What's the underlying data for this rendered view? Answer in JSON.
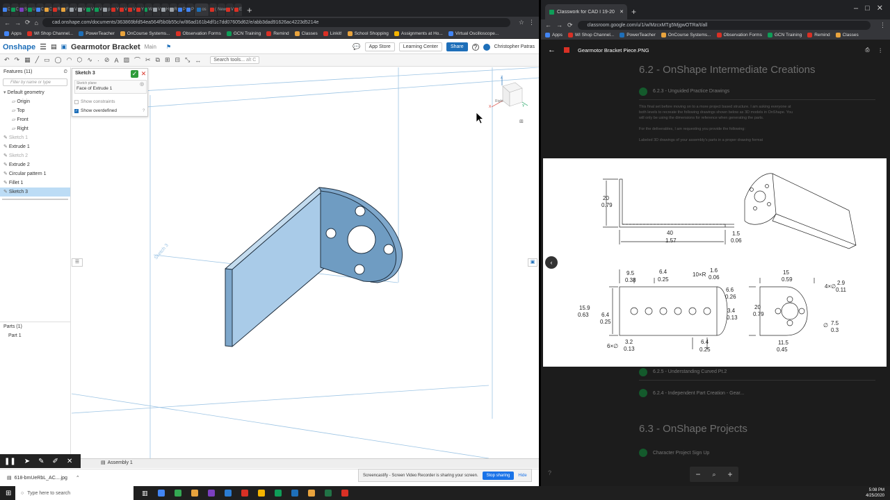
{
  "left_browser": {
    "url": "cad.onshape.com/documents/363869bfd54ea564f5b0b55c/w/86ad161b4df1c7dd07605d62/e/abb3dad91626ac4223d5214e",
    "bookmarks": [
      "Apps",
      "WI Shop Channel...",
      "PowerTeacher",
      "OnCourse Systems...",
      "Observation Forms",
      "GCN Training",
      "Remind",
      "Classes",
      "Linkit!",
      "School Shopping",
      "Assignments at Ho...",
      "Virtual Oscilloscope..."
    ],
    "tabs": [
      {
        "label": "C",
        "color": "#4285f4"
      },
      {
        "label": "C",
        "color": "#0f9d58"
      },
      {
        "label": "S",
        "color": "#7b3fbf"
      },
      {
        "label": "U",
        "color": "#0f9d58"
      },
      {
        "label": "C",
        "color": "#4285f4"
      },
      {
        "label": "C",
        "color": "#e8a33d"
      },
      {
        "label": "R",
        "color": "#d93025"
      },
      {
        "label": "F",
        "color": "#e8a33d"
      },
      {
        "label": "V",
        "color": "#9aa0a6"
      },
      {
        "label": "V",
        "color": "#9aa0a6"
      },
      {
        "label": "V",
        "color": "#0f9d58"
      },
      {
        "label": "V",
        "color": "#0f9d58"
      },
      {
        "label": "p",
        "color": "#9aa0a6"
      },
      {
        "label": "Y",
        "color": "#d93025"
      },
      {
        "label": "V",
        "color": "#d93025"
      },
      {
        "label": "V",
        "color": "#d93025"
      },
      {
        "label": "Y",
        "color": "#d93025"
      },
      {
        "label": "W",
        "color": "#0f9d58"
      },
      {
        "label": "V",
        "color": "#9aa0a6"
      },
      {
        "label": "H",
        "color": "#9aa0a6"
      },
      {
        "label": "R",
        "color": "#9aa0a6"
      },
      {
        "label": "P",
        "color": "#4285f4"
      },
      {
        "label": "P",
        "color": "#4285f4"
      },
      {
        "label": "os",
        "color": "#1e6fb9",
        "active": true
      },
      {
        "label": "(",
        "color": "#d93025"
      },
      {
        "label": "New",
        "color": "#9aa0a6"
      },
      {
        "label": "V",
        "color": "#d93025"
      },
      {
        "label": "E",
        "color": "#d93025"
      }
    ]
  },
  "onshape": {
    "logo": "Onshape",
    "doc_title": "Gearmotor Bracket",
    "branch": "Main",
    "app_store": "App Store",
    "learning_center": "Learning Center",
    "share": "Share",
    "help": "?",
    "user": "Christopher Patras",
    "search_tools": "Search tools...",
    "search_shortcut": "alt C",
    "features_header": "Features (11)",
    "filter_placeholder": "Filter by name or type",
    "tree": [
      {
        "label": "Default geometry",
        "level": 0,
        "dim": false
      },
      {
        "label": "Origin",
        "level": 1,
        "dim": false
      },
      {
        "label": "Top",
        "level": 1,
        "dim": false
      },
      {
        "label": "Front",
        "level": 1,
        "dim": false
      },
      {
        "label": "Right",
        "level": 1,
        "dim": false
      },
      {
        "label": "Sketch 1",
        "level": 0,
        "dim": true
      },
      {
        "label": "Extrude 1",
        "level": 0,
        "dim": false
      },
      {
        "label": "Sketch 2",
        "level": 0,
        "dim": true
      },
      {
        "label": "Extrude 2",
        "level": 0,
        "dim": false
      },
      {
        "label": "Circular pattern 1",
        "level": 0,
        "dim": false
      },
      {
        "label": "Fillet 1",
        "level": 0,
        "dim": false
      },
      {
        "label": "Sketch 3",
        "level": 0,
        "dim": false,
        "selected": true
      }
    ],
    "parts_header": "Parts (1)",
    "parts": [
      "Part 1"
    ],
    "sketch_panel": {
      "title": "Sketch 3",
      "plane_label": "Sketch plane",
      "plane_value": "Face of Extrude 1",
      "show_constraints": "Show constraints",
      "show_overdefined": "Show overdefined"
    },
    "sketch_label": "Sketch 3",
    "viewcube_face": "Right",
    "axis_x": "X",
    "axis_y": "Y",
    "axis_z": "Z",
    "assembly_tab": "Assembly 1",
    "download_file": "618-bmUeRbL_AC....jpg",
    "share_notice": "Screencastify - Screen Video Recorder is sharing your screen.",
    "stop_sharing": "Stop sharing",
    "hide": "Hide"
  },
  "right_browser": {
    "tab_title": "Classwork for CAD I 19-20",
    "url": "classroom.google.com/u/1/w/MzcxMTg5MjgwOTRa/t/all",
    "bookmarks": [
      "Apps",
      "WI Shop Channel...",
      "PowerTeacher",
      "OnCourse Systems...",
      "Observation Forms",
      "GCN Training",
      "Remind",
      "Classes"
    ],
    "viewer_title": "Gearmotor Bracket Piece.PNG",
    "section1": "6.2 - OnShape Intermediate Creations",
    "assignment1": "6.2.3 - Unguided Practice Drawings",
    "desc1": "This final set before moving on to a more project based structure. I am asking everyone at both levels to recreate the following drawings shown below as 3D models in OnShape. You will only be using the dimensions for reference when generating the parts.",
    "desc2": "For the deliverables, I am requesting you provide the following:",
    "desc3": "Labeled 3D drawings of your assembly's parts in a proper drawing format",
    "assignment2": "6.2.5 - Understanding Curved Pt.2",
    "assignment3": "6.2.4 - Independent Part Creation - Gear...",
    "section2": "6.3 - OnShape Projects",
    "assignment4": "Character Project Sign Up"
  },
  "drawing": {
    "dims": {
      "h20": "20",
      "h20in": "0.79",
      "l40": "40",
      "l40in": "1.57",
      "t15": "1.5",
      "t15in": "0.06",
      "d95": "9.5",
      "d95in": "0.38",
      "d64a": "6.4",
      "d64ain": "0.25",
      "rad": "10×R",
      "rad_val": "1.6",
      "rad_in": "0.06",
      "d66": "6.6",
      "d66in": "0.26",
      "d159": "15.9",
      "d159in": "0.63",
      "d64b": "6.4",
      "d64bin": "0.25",
      "d34": "3.4",
      "d34in": "0.13",
      "hole6": "6×∅",
      "hole6v": "3.2",
      "hole6in": "0.13",
      "d64c": "6.4",
      "d64cin": "0.25",
      "w15": "15",
      "w15in": "0.59",
      "h20b": "20",
      "h20bin": "0.79",
      "hole4": "4×∅",
      "hole4v": "2.9",
      "hole4in": "0.11",
      "hole75": "∅",
      "hole75v": "7.5",
      "hole75in": "0.3",
      "d115": "11.5",
      "d115in": "0.45"
    }
  },
  "taskbar": {
    "search_placeholder": "Type here to search",
    "time": "5:08 PM",
    "date": "4/25/2020",
    "icons": [
      "#4285f4",
      "#34a853",
      "#e8a33d",
      "#7b3fbf",
      "#2b7cd3",
      "#d93025",
      "#f4b400",
      "#0f9d58",
      "#1e6fb9",
      "#e8a33d",
      "#217346",
      "#d93025"
    ]
  },
  "colors": {
    "part_face": "#a9cbe8",
    "part_face_dark": "#6f9cc2",
    "part_edge": "#1f2f3f",
    "accent": "#1e6fb9"
  }
}
